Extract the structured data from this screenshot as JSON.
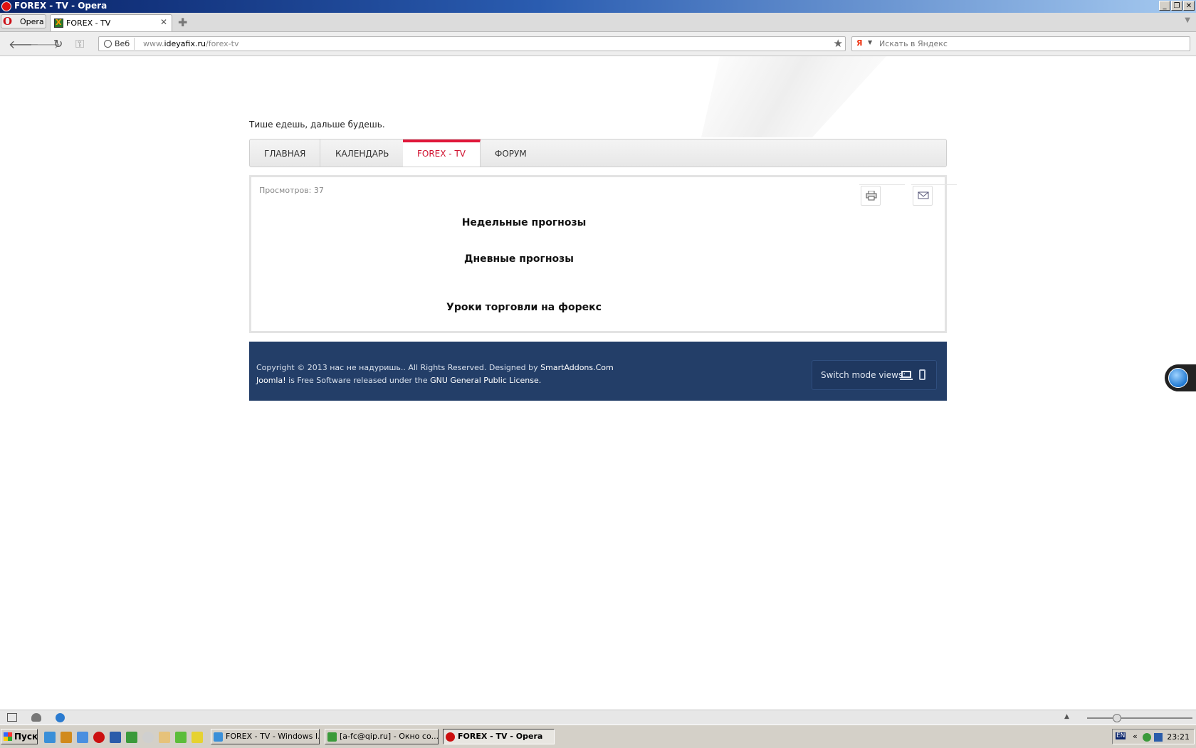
{
  "window": {
    "title": "FOREX - TV - Opera"
  },
  "tabs": {
    "menu_label": "Opera",
    "active_tab": "FOREX - TV"
  },
  "address": {
    "scope_label": "Веб",
    "url_prefix": "www.",
    "url_domain": "ideyafix.ru",
    "url_path": "/forex-tv",
    "search_placeholder": "Искать в Яндекс",
    "search_engine_badge": "Я"
  },
  "page": {
    "slogan": "Тише едешь, дальше будешь.",
    "menu": [
      {
        "label": "ГЛАВНАЯ",
        "active": false
      },
      {
        "label": "КАЛЕНДАРЬ",
        "active": false
      },
      {
        "label": "FOREX - TV",
        "active": true
      },
      {
        "label": "ФОРУМ",
        "active": false
      }
    ],
    "views_text": "Просмотров: 37",
    "headings": [
      "Недельные прогнозы",
      "Дневные прогнозы",
      "Уроки торговли на форекс"
    ],
    "footer": {
      "copyright": "Copyright © 2013 нас не надуришь.. All Rights Reserved. Designed by",
      "designer_link": "SmartAddons.Com",
      "joomla_link": "Joomla!",
      "license_text": "is Free Software released under the",
      "license_link": "GNU General Public License.",
      "switch_label": "Switch mode views:"
    }
  },
  "taskbar": {
    "start_label": "Пуск",
    "buttons": [
      "FOREX - TV - Windows I...",
      "[a-fc@qip.ru] - Окно со...",
      "FOREX - TV - Opera"
    ],
    "lang": "EN",
    "clock": "23:21"
  },
  "colors": {
    "accent": "#e0173a",
    "footer_bg": "#233e68"
  }
}
